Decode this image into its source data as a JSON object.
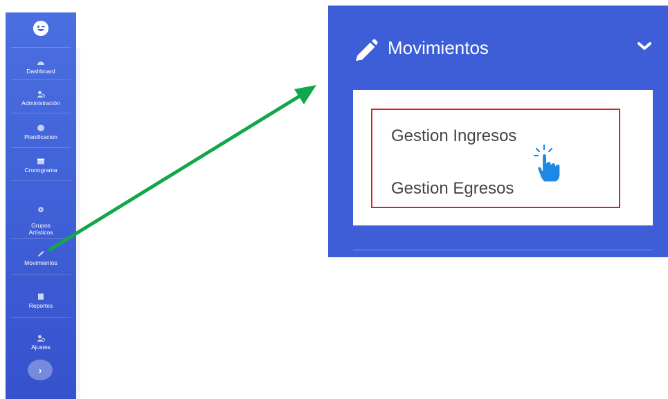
{
  "sidebar": {
    "items": [
      {
        "label": "Dashboard",
        "icon": "dashboard-icon"
      },
      {
        "label": "Administración",
        "icon": "users-icon"
      },
      {
        "label": "Planificacion",
        "icon": "circle-icon"
      },
      {
        "label": "Cronograma",
        "icon": "calendar-icon"
      },
      {
        "label": "Grupos\nArtísticos",
        "icon": "gear-icon"
      },
      {
        "label": "Movimientos",
        "icon": "pencil-icon"
      },
      {
        "label": "Reportes",
        "icon": "book-icon"
      },
      {
        "label": "Ajustes",
        "icon": "users-icon"
      }
    ],
    "toggle_label": "›"
  },
  "zoom": {
    "title": "Movimientos",
    "items": [
      {
        "label": "Gestion Ingresos"
      },
      {
        "label": "Gestion Egresos"
      }
    ]
  },
  "colors": {
    "sidebar": "#4365dc",
    "panel": "#3d5ed6",
    "arrow": "#11a84a",
    "highlight": "#e02020",
    "cursor": "#1e88e5"
  }
}
